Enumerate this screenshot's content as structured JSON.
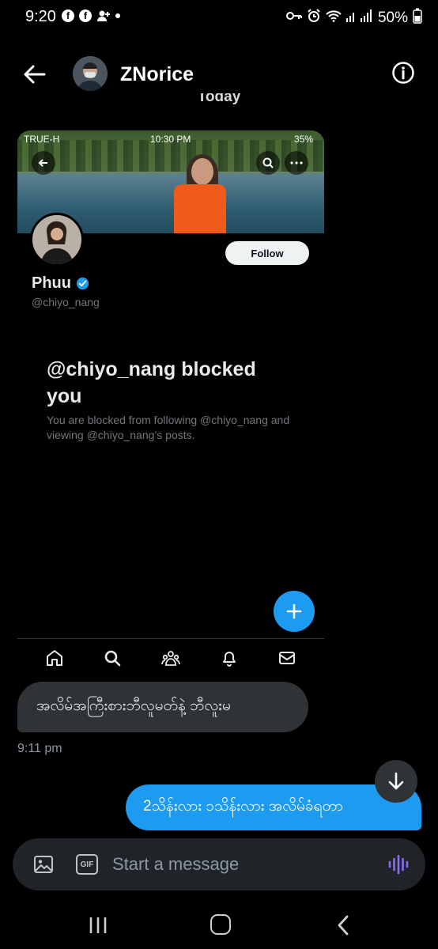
{
  "status_bar": {
    "time": "9:20",
    "battery": "50%",
    "notification_icons": [
      "facebook-icon",
      "facebook-icon",
      "person-add-icon",
      "dot-icon"
    ],
    "status_icons": [
      "key-icon",
      "alarm-icon",
      "wifi-icon",
      "signal-icon",
      "battery-icon"
    ]
  },
  "header": {
    "title": "ZNorice",
    "back_icon": "arrow-left-icon",
    "info_icon": "info-icon"
  },
  "date_separator": "Today",
  "shared_image": {
    "inner_status": {
      "carrier": "TRUE-H",
      "time": "10:30 PM",
      "battery": "35%"
    },
    "profile": {
      "name": "Phuu",
      "handle": "@chiyo_nang",
      "verified": true,
      "follow_label": "Follow"
    },
    "blocked_title": "@chiyo_nang blocked you",
    "blocked_description": "You are blocked from following @chiyo_nang and viewing @chiyo_nang’s posts.",
    "tabs": [
      "home-icon",
      "search-icon",
      "communities-icon",
      "bell-icon",
      "mail-icon"
    ]
  },
  "messages": [
    {
      "direction": "incoming",
      "text": "အလိမ်အကြီးစားဘီလူမတ်နဲ့ ဘီလူးမ"
    },
    {
      "direction": "timestamp",
      "text": "9:11 pm"
    },
    {
      "direction": "outgoing",
      "text": "2သိန်းလား ၁သိန်းလား အလိမ်ခံရတာ"
    }
  ],
  "composer": {
    "placeholder": "Start a message",
    "gif_label": "GIF"
  },
  "colors": {
    "accent": "#1d9bf0",
    "incoming_bubble": "#2f3336",
    "composer_bg": "#202327",
    "voice_icon": "#8a6cf0"
  }
}
